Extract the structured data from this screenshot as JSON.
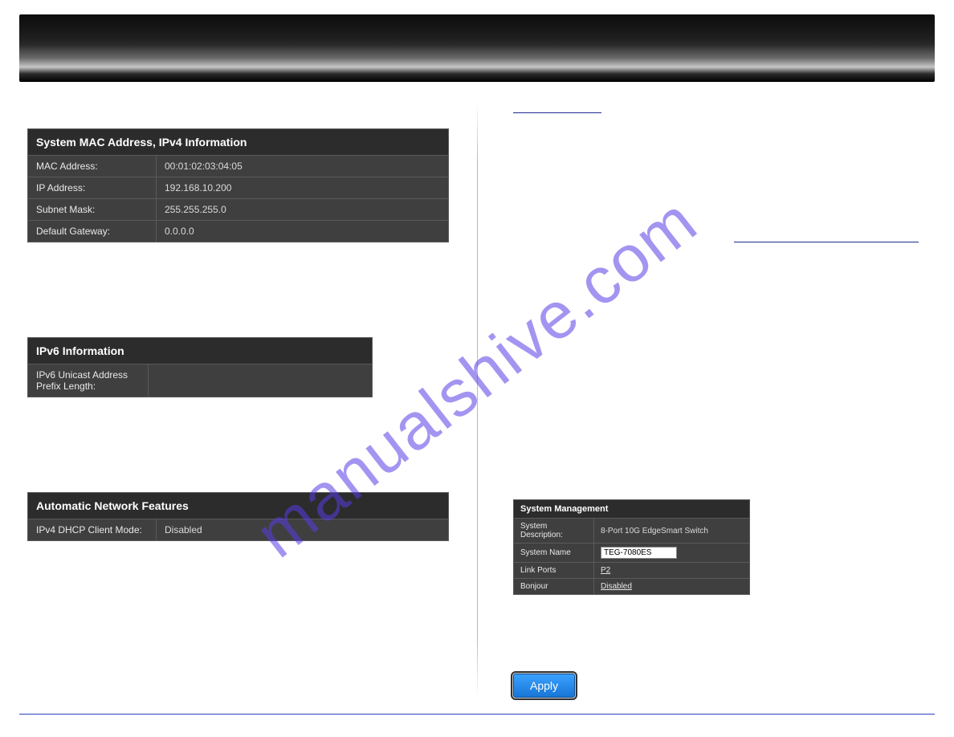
{
  "watermark": "manualshive.com",
  "ipv4_panel": {
    "title": "System MAC Address, IPv4 Information",
    "rows": [
      {
        "label": "MAC Address:",
        "value": "00:01:02:03:04:05"
      },
      {
        "label": "IP Address:",
        "value": "192.168.10.200"
      },
      {
        "label": "Subnet Mask:",
        "value": "255.255.255.0"
      },
      {
        "label": "Default Gateway:",
        "value": "0.0.0.0"
      }
    ]
  },
  "ipv6_panel": {
    "title": "IPv6 Information",
    "rows": [
      {
        "label": "IPv6 Unicast Address Prefix Length:",
        "value": ""
      }
    ]
  },
  "auto_panel": {
    "title": "Automatic Network Features",
    "rows": [
      {
        "label": "IPv4 DHCP Client Mode:",
        "value": "Disabled"
      }
    ]
  },
  "sys_mgmt": {
    "title": "System Management",
    "rows": {
      "desc_label": "System Description:",
      "desc_value": "8-Port 10G EdgeSmart Switch",
      "name_label": "System Name",
      "name_value": "TEG-7080ES",
      "links_label": "Link Ports",
      "links_value": "P2",
      "bonjour_label": "Bonjour",
      "bonjour_value": "Disabled"
    }
  },
  "apply_label": "Apply"
}
